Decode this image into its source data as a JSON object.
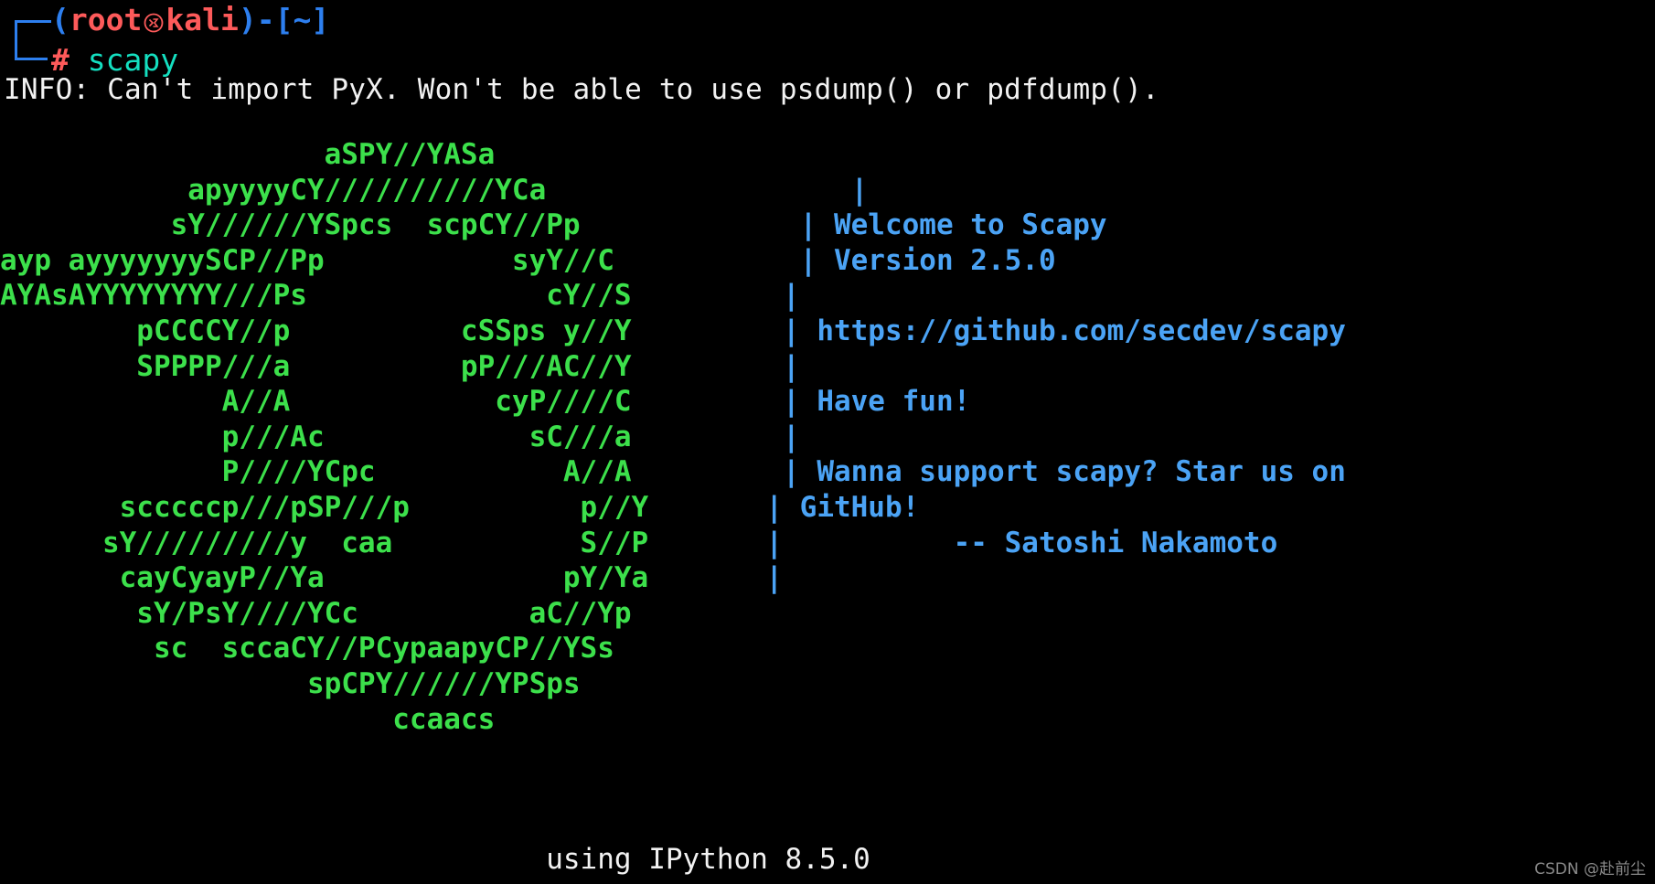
{
  "terminal": {
    "background_color": "#000000",
    "prompt": {
      "open_paren": "(",
      "user": "root",
      "separator": " ",
      "host": "kali",
      "close_paren": ")",
      "dash": "-",
      "path_open": "[",
      "path": "~",
      "path_close": "]",
      "symbol": "#",
      "command": "scapy",
      "icon_name": "kali-dragon-icon",
      "colors": {
        "bracket": "#2d7fef",
        "user_host": "#fd5a5a",
        "command": "#14dfc0",
        "hash": "#fd5a5a"
      }
    },
    "info_message": "INFO: Can't import PyX. Won't be able to use psdump() or pdfdump().",
    "banner": {
      "art_color": "#3ce04b",
      "side_color": "#4ba3f5",
      "rows": [
        {
          "art": "                   aSPY//YASa",
          "side": ""
        },
        {
          "art": "           apyyyyCY//////////YCa",
          "side": "       |"
        },
        {
          "art": "          sY//////YSpcs  scpCY//Pp",
          "side": "    | Welcome to Scapy"
        },
        {
          "art": "ayp ayyyyyyySCP//Pp           syY//C",
          "side": "    | Version 2.5.0"
        },
        {
          "art": "AYAsAYYYYYYYY///Ps              cY//S",
          "side": "   |"
        },
        {
          "art": "        pCCCCY//p          cSSps y//Y",
          "side": "   | https://github.com/secdev/scapy"
        },
        {
          "art": "        SPPPP///a          pP///AC//Y",
          "side": "   |"
        },
        {
          "art": "             A//A            cyP////C",
          "side": "   | Have fun!"
        },
        {
          "art": "             p///Ac            sC///a",
          "side": "   |"
        },
        {
          "art": "             P////YCpc           A//A",
          "side": "   | Wanna support scapy? Star us on"
        },
        {
          "art": "       scccccp///pSP///p          p//Y",
          "side": "  | GitHub!"
        },
        {
          "art": "      sY/////////y  caa           S//P",
          "side": "  |          -- Satoshi Nakamoto"
        },
        {
          "art": "       cayCyayP//Ya              pY/Ya",
          "side": "  |"
        },
        {
          "art": "        sY/PsY////YCc          aC//Yp",
          "side": ""
        },
        {
          "art": "         sc  sccaCY//PCypaapyCP//YSs",
          "side": ""
        },
        {
          "art": "                  spCPY//////YPSps",
          "side": ""
        },
        {
          "art": "                       ccaacs",
          "side": ""
        }
      ]
    },
    "footer": "                                using IPython 8.5.0",
    "watermark": "CSDN @赴前尘"
  }
}
